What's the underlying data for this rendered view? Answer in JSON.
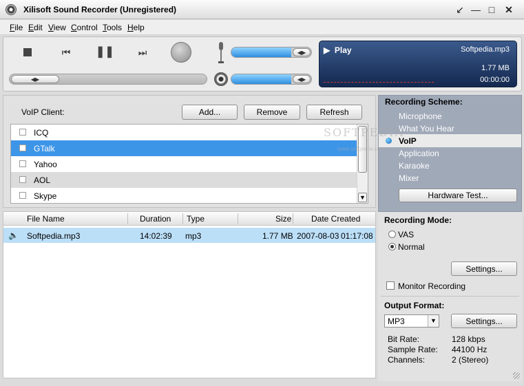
{
  "window": {
    "title": "Xilisoft Sound Recorder (Unregistered)",
    "controls": {
      "minimize_icon": "minimize-icon",
      "maximize_icon": "maximize-icon",
      "close_icon": "close-icon"
    }
  },
  "menu": [
    {
      "first": "F",
      "rest": "ile"
    },
    {
      "first": "E",
      "rest": "dit"
    },
    {
      "first": "V",
      "rest": "iew"
    },
    {
      "first": "C",
      "rest": "ontrol"
    },
    {
      "first": "T",
      "rest": "ools"
    },
    {
      "first": "H",
      "rest": "elp"
    }
  ],
  "display": {
    "play_label": "Play",
    "file_name": "Softpedia.mp3",
    "size": "1.77 MB",
    "time": "00:00:00"
  },
  "levels": {
    "record_volume": 0.75,
    "playback_volume": 0.75,
    "progress": 0.25
  },
  "voip": {
    "label": "VoIP Client:",
    "add_label": "Add...",
    "remove_label": "Remove",
    "refresh_label": "Refresh",
    "clients": [
      "ICQ",
      "GTalk",
      "Yahoo",
      "AOL",
      "Skype"
    ],
    "selected_index": 1
  },
  "files": {
    "columns": [
      "File Name",
      "Duration",
      "Type",
      "Size",
      "Date Created"
    ],
    "rows": [
      {
        "name": "Softpedia.mp3",
        "duration": "14:02:39",
        "type": "mp3",
        "size": "1.77 MB",
        "date": "2007-08-03",
        "time": "01:17:08"
      }
    ]
  },
  "scheme": {
    "heading": "Recording Scheme:",
    "items": [
      "Microphone",
      "What You Hear",
      "VoIP",
      "Application",
      "Karaoke",
      "Mixer"
    ],
    "selected": "VoIP",
    "hardware_test_label": "Hardware Test..."
  },
  "mode": {
    "heading": "Recording Mode:",
    "options": [
      "VAS",
      "Normal"
    ],
    "selected": "Normal",
    "settings_label": "Settings...",
    "monitor_label": "Monitor Recording",
    "monitor_checked": false
  },
  "output": {
    "heading": "Output Format:",
    "format": "MP3",
    "settings_label": "Settings...",
    "bit_rate_label": "Bit Rate:",
    "bit_rate": "128 kbps",
    "sample_rate_label": "Sample Rate:",
    "sample_rate": "44100 Hz",
    "channels_label": "Channels:",
    "channels": "2 (Stereo)"
  },
  "watermark": {
    "main": "SOFTPEDIA",
    "sub": "www.softpedia.com"
  },
  "colors": {
    "selection": "#3d95e8",
    "display_bg": "#1b3563",
    "scheme_bg": "#a0a9b8"
  }
}
